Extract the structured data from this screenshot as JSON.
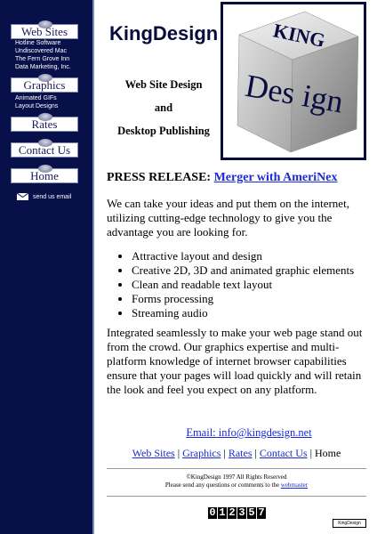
{
  "sidebar": {
    "buttons": {
      "web_sites": "Web Sites",
      "graphics": "Graphics",
      "rates": "Rates",
      "contact_us": "Contact Us",
      "home": "Home"
    },
    "web_sites_items": [
      "Hotline Software",
      "Undiscovered Mac",
      "The Fern Grove Inn",
      "Data Marketing, Inc."
    ],
    "graphics_items": [
      "Animated GIFs",
      "Layout Designs"
    ],
    "email_label": "send us email"
  },
  "header": {
    "brand": "KingDesign",
    "tagline": [
      "Web Site Design",
      "and",
      "Desktop Publishing"
    ],
    "logo_text_top": "KING",
    "logo_text_bottom": "Des ign"
  },
  "main": {
    "press_label": "PRESS RELEASE:",
    "press_link": "Merger with AmeriNex",
    "intro": "We can take your ideas and put them on the internet, utilizing cutting-edge technology to give you the advantage you are looking for.",
    "features": [
      "Attractive layout and design",
      "Creative 2D, 3D and animated graphic elements",
      "Clean and readable text layout",
      "Forms processing",
      "Streaming audio"
    ],
    "closing": "Integrated seamlessly to make your web page stand out from the crowd. Our graphics expertise and multi-platform knowledge of internet browser capabilities ensure that your pages will load quickly and will retain the look and feel you expect on any platform.",
    "email_line": "Email: info@kingdesign.net"
  },
  "footer": {
    "nav": [
      "Web Sites",
      "Graphics",
      "Rates",
      "Contact Us",
      "Home"
    ],
    "copyright": "©KingDesign 1997 All Rights Reserved",
    "contact_text": "Please send any questions or comments to the",
    "webmaster": "webmaster",
    "counter": [
      "0",
      "1",
      "2",
      "3",
      "5",
      "7"
    ],
    "badge": "KingDesign"
  }
}
